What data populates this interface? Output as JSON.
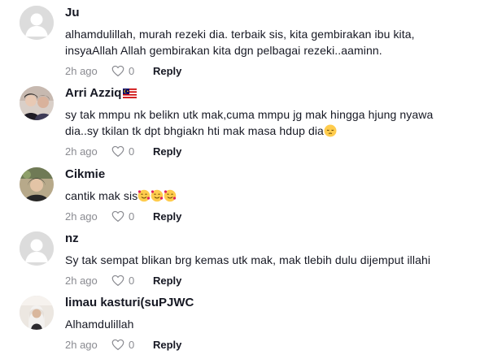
{
  "comments": [
    {
      "author": "Ju",
      "text": "alhamdulillah, murah rezeki dia. terbaik sis, kita gembirakan ibu kita, insyaAllah Allah gembirakan kita dgn pelbagai rezeki..aaminn.",
      "time": "2h ago",
      "likes": "0",
      "reply_label": "Reply"
    },
    {
      "author": "Arri Azziq",
      "author_flag": "malaysia-flag",
      "text": "sy tak mmpu nk belikn utk mak,cuma mmpu jg mak hingga hjung nyawa dia..sy tkilan tk dpt bhgiakn hti mak masa hdup dia",
      "text_emoji": "pensive-face",
      "time": "2h ago",
      "likes": "0",
      "reply_label": "Reply"
    },
    {
      "author": "Cikmie",
      "text": "cantik mak sis",
      "text_emoji": "smiling-face-with-hearts x3",
      "time": "2h ago",
      "likes": "0",
      "reply_label": "Reply"
    },
    {
      "author": "nz",
      "text": "Sy tak sempat blikan brg kemas utk mak, mak tlebih dulu dijemput illahi",
      "time": "2h ago",
      "likes": "0",
      "reply_label": "Reply"
    },
    {
      "author": "limau kasturi(suPJWC",
      "text": "Alhamdulillah",
      "time": "2h ago",
      "likes": "0",
      "reply_label": "Reply"
    }
  ],
  "icons": {
    "like": "heart-outline-icon",
    "default_avatar": "default-avatar-icon"
  },
  "colors": {
    "name": "#161823",
    "meta": "#8a8b91",
    "avatar_placeholder": "#dcdcdc"
  }
}
